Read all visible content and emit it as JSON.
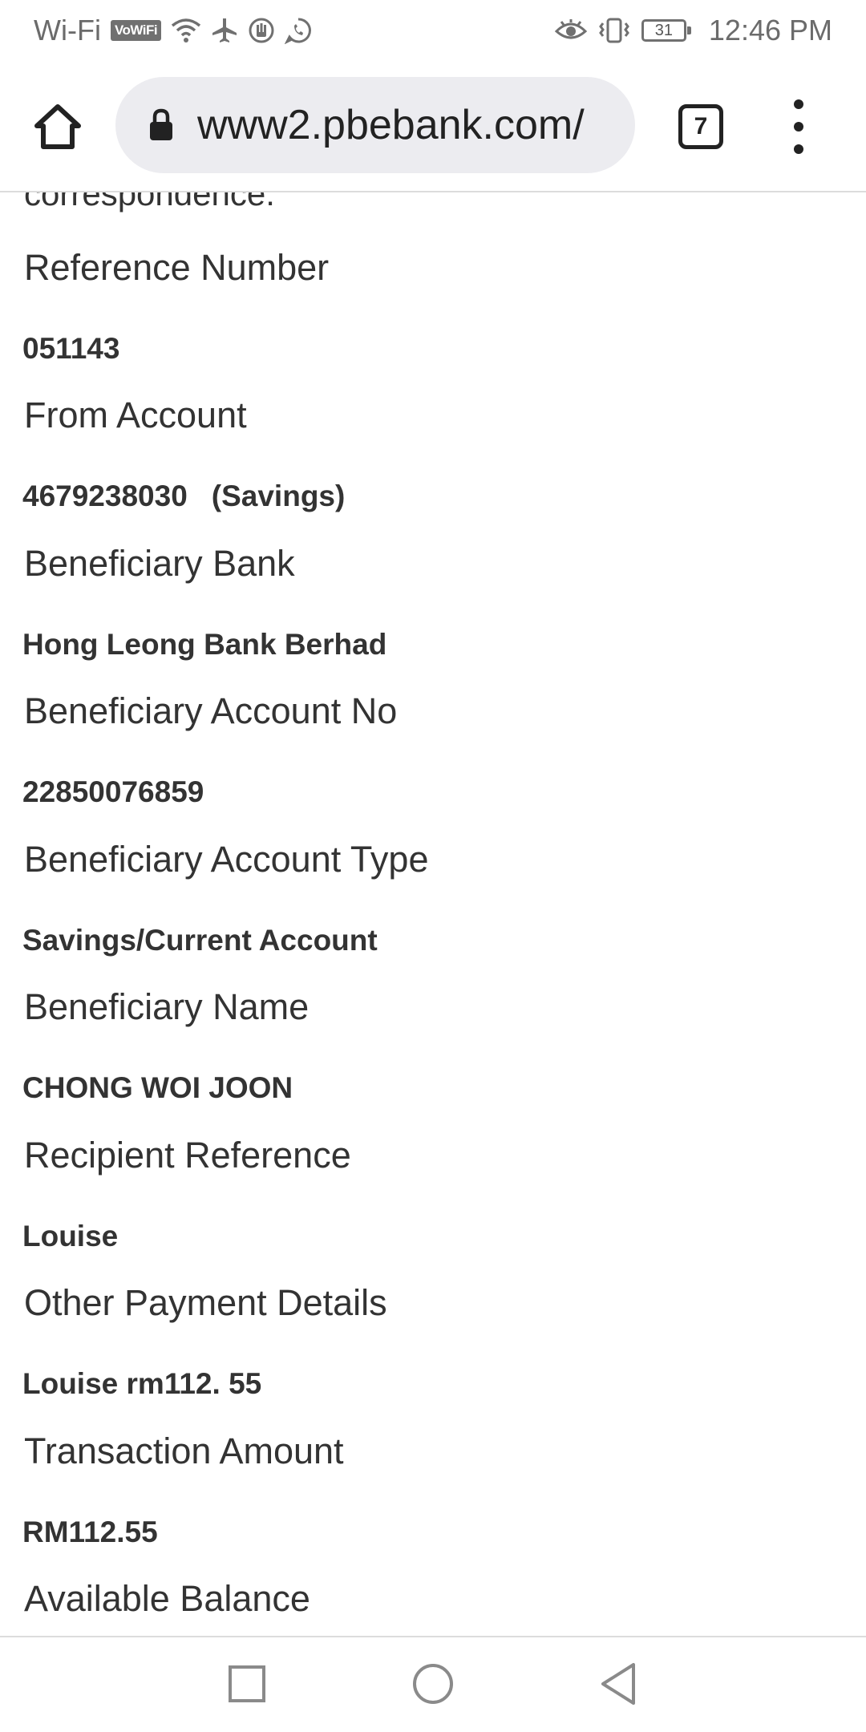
{
  "status_bar": {
    "wifi_label": "Wi-Fi",
    "vowifi_badge": "VoWiFi",
    "battery_level": "31",
    "time": "12:46 PM",
    "icons": [
      "wifi-icon",
      "airplane-icon",
      "hand-icon",
      "whatsapp-icon",
      "eye-icon",
      "vibrate-icon",
      "battery-icon"
    ]
  },
  "browser": {
    "url": "www2.pbebank.com/",
    "tab_count": "7",
    "icons": [
      "home-icon",
      "lock-icon",
      "tab-switcher-icon",
      "more-vert-icon"
    ]
  },
  "page": {
    "intro_text": "correspondence.",
    "fields": [
      {
        "label": "Reference Number",
        "value": "051143"
      },
      {
        "label": "From Account",
        "value": "4679238030",
        "value_suffix": "(Savings)"
      },
      {
        "label": "Beneficiary Bank",
        "value": "Hong Leong Bank Berhad"
      },
      {
        "label": "Beneficiary Account No",
        "value": "22850076859"
      },
      {
        "label": "Beneficiary Account Type",
        "value": "Savings/Current Account"
      },
      {
        "label": "Beneficiary Name",
        "value": "CHONG WOI JOON"
      },
      {
        "label": "Recipient Reference",
        "value": "Louise"
      },
      {
        "label": "Other Payment Details",
        "value": "Louise rm112. 55"
      },
      {
        "label": "Transaction Amount",
        "value": "RM112.55"
      },
      {
        "label": "Available Balance",
        "value": ""
      }
    ]
  },
  "nav_bar": {
    "icons": [
      "recents-icon",
      "home-circle-icon",
      "back-icon"
    ]
  }
}
